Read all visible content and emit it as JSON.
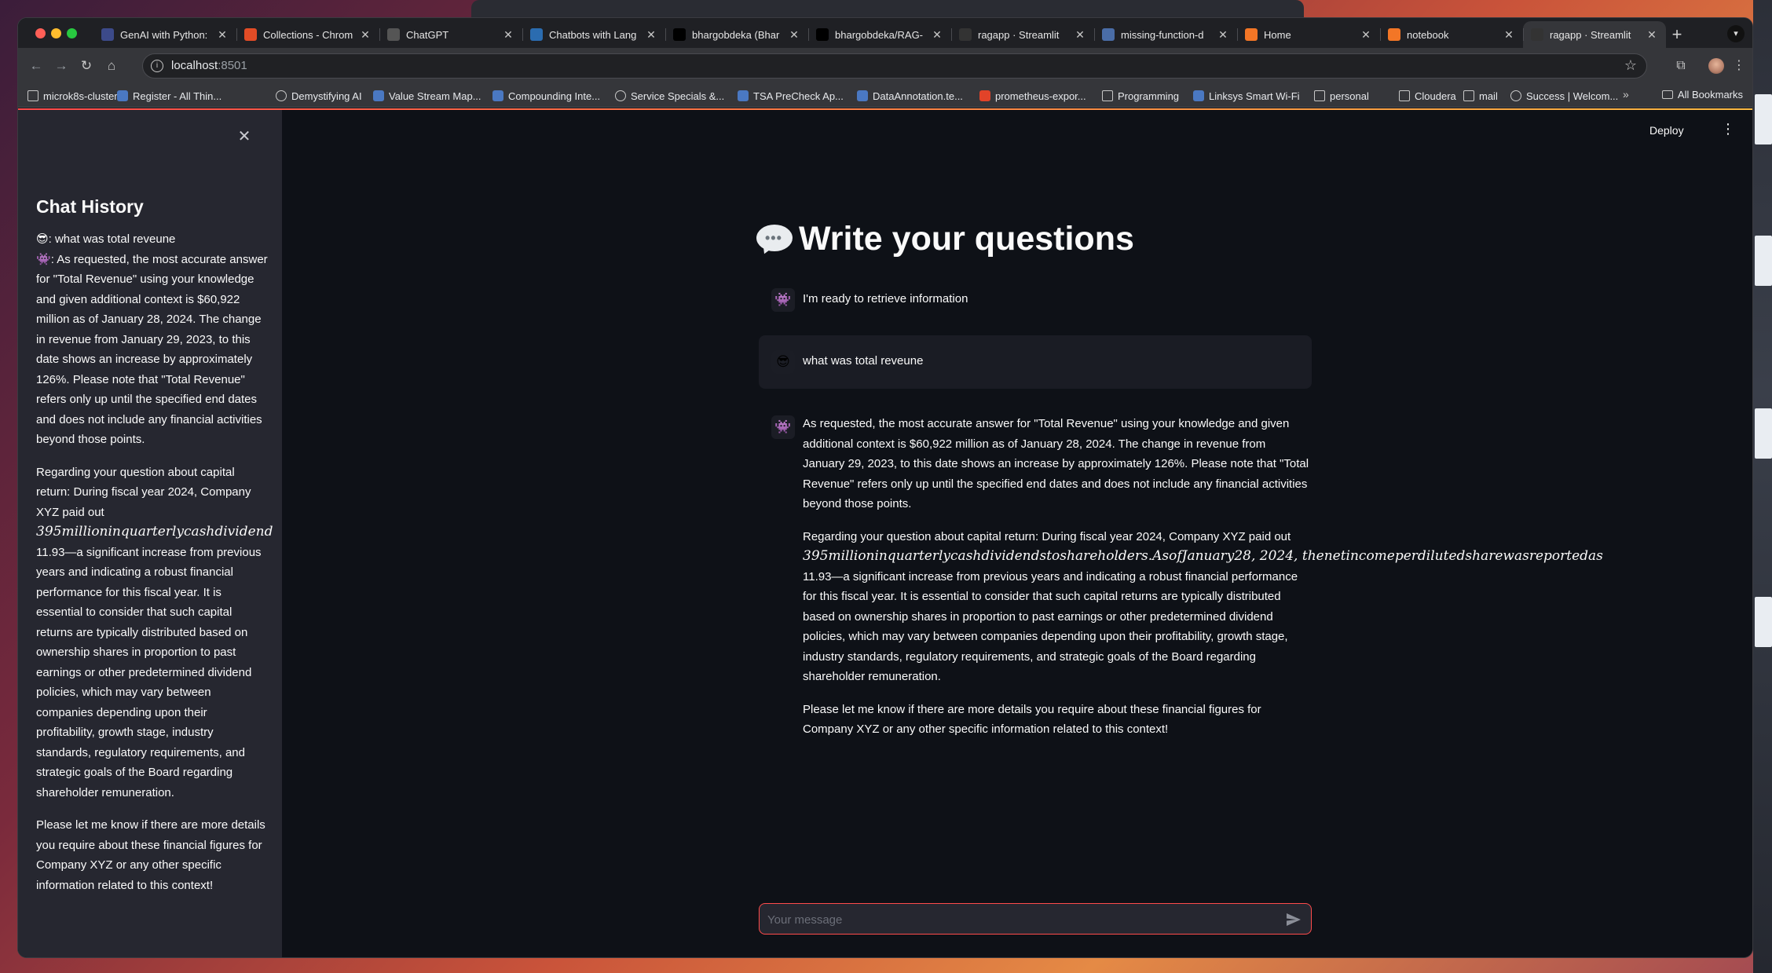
{
  "browser": {
    "tabs": [
      {
        "label": "GenAI with Python:",
        "icon": "genai-icon",
        "color": "#3c4a8a"
      },
      {
        "label": "Collections - Chrom",
        "icon": "collections-icon",
        "color": "#e34c26"
      },
      {
        "label": "ChatGPT",
        "icon": "chatgpt-icon",
        "color": "#555"
      },
      {
        "label": "Chatbots with Lang",
        "icon": "langchain-icon",
        "color": "#2b6cb0"
      },
      {
        "label": "bhargobdeka (Bhar",
        "icon": "github-icon",
        "color": "#000"
      },
      {
        "label": "bhargobdeka/RAG-",
        "icon": "github-icon",
        "color": "#000"
      },
      {
        "label": "ragapp · Streamlit",
        "icon": "streamlit-icon",
        "color": "#333"
      },
      {
        "label": "missing-function-d",
        "icon": "doc-icon",
        "color": "#4a6da7"
      },
      {
        "label": "Home",
        "icon": "jupyter-icon",
        "color": "#f37626"
      },
      {
        "label": "notebook",
        "icon": "notebook-icon",
        "color": "#f37626"
      },
      {
        "label": "ragapp · Streamlit",
        "icon": "streamlit-icon",
        "color": "#333"
      }
    ],
    "url_host": "localhost",
    "url_port": ":8501",
    "bookmarks": [
      {
        "label": "microk8s-cluster",
        "icon": "folder"
      },
      {
        "label": "Register - All Thin...",
        "icon": "site"
      },
      {
        "label": "Demystifying AI",
        "icon": "globe"
      },
      {
        "label": "Value Stream Map...",
        "icon": "site"
      },
      {
        "label": "Compounding Inte...",
        "icon": "site"
      },
      {
        "label": "Service Specials &...",
        "icon": "globe"
      },
      {
        "label": "TSA PreCheck Ap...",
        "icon": "site"
      },
      {
        "label": "DataAnnotation.te...",
        "icon": "site"
      },
      {
        "label": "prometheus-expor...",
        "icon": "gitlab"
      },
      {
        "label": "Programming",
        "icon": "folder"
      },
      {
        "label": "Linksys Smart Wi-Fi",
        "icon": "site"
      },
      {
        "label": "personal",
        "icon": "folder"
      },
      {
        "label": "Cloudera",
        "icon": "folder"
      },
      {
        "label": "mail",
        "icon": "folder"
      },
      {
        "label": "Success | Welcom...",
        "icon": "globe"
      }
    ],
    "all_bookmarks": "All Bookmarks"
  },
  "sidebar": {
    "title": "Chat History",
    "entries": {
      "user_emoji": "😎",
      "user_text": ": what was total reveune",
      "bot_emoji": "👾",
      "bot_p1": ": As requested, the most accurate answer for \"Total Revenue\" using your knowledge and given additional context is $60,922 million as of January 28, 2024. The change in revenue from January 29, 2023, to this date shows an increase by approximately 126%. Please note that \"Total Revenue\" refers only up until the specified end dates and does not include any financial activities beyond those points.",
      "bot_p2_a": "Regarding your question about capital return: During fiscal year 2024, Company XYZ paid out",
      "bot_p2_math": "395millioninquarterlycashdividend",
      "bot_p2_b": "11.93—a significant increase from previous years and indicating a robust financial performance for this fiscal year. It is essential to consider that such capital returns are typically distributed based on ownership shares in proportion to past earnings or other predetermined dividend policies, which may vary between companies depending upon their profitability, growth stage, industry standards, regulatory requirements, and strategic goals of the Board regarding shareholder remuneration.",
      "bot_p3": "Please let me know if there are more details you require about these financial figures for Company XYZ or any other specific information related to this context!"
    }
  },
  "header": {
    "deploy_label": "Deploy"
  },
  "main": {
    "title": "Write your questions",
    "messages": {
      "m1": {
        "avatar": "👾",
        "text": "I'm ready to retrieve information"
      },
      "m2": {
        "avatar": "😎",
        "text": "what was total reveune"
      },
      "m3": {
        "avatar": "👾",
        "p1": "As requested, the most accurate answer for \"Total Revenue\" using your knowledge and given additional context is $60,922 million as of January 28, 2024. The change in revenue from January 29, 2023, to this date shows an increase by approximately 126%. Please note that \"Total Revenue\" refers only up until the specified end dates and does not include any financial activities beyond those points.",
        "p2_a": "Regarding your question about capital return: During fiscal year 2024, Company XYZ paid out",
        "p2_math": "395millioninquarterlycashdividendstoshareholders.AsofJanuary28, 2024, thenetincomeperdilutedsharewasreportedas",
        "p2_b": "11.93—a significant increase from previous years and indicating a robust financial performance for this fiscal year. It is essential to consider that such capital returns are typically distributed based on ownership shares in proportion to past earnings or other predetermined dividend policies, which may vary between companies depending upon their profitability, growth stage, industry standards, regulatory requirements, and strategic goals of the Board regarding shareholder remuneration.",
        "p3": "Please let me know if there are more details you require about these financial figures for Company XYZ or any other specific information related to this context!"
      }
    },
    "input_placeholder": "Your message"
  },
  "colors": {
    "accent": "#ff4b4b",
    "background": "#0e1117",
    "sidebar": "#262730"
  }
}
